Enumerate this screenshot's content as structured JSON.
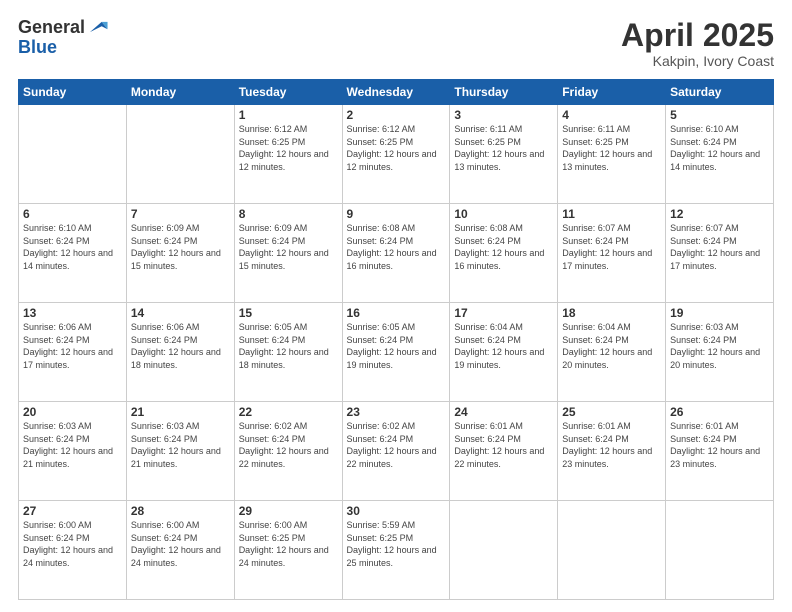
{
  "logo": {
    "general": "General",
    "blue": "Blue"
  },
  "header": {
    "month": "April 2025",
    "location": "Kakpin, Ivory Coast"
  },
  "weekdays": [
    "Sunday",
    "Monday",
    "Tuesday",
    "Wednesday",
    "Thursday",
    "Friday",
    "Saturday"
  ],
  "weeks": [
    [
      {
        "day": "",
        "sunrise": "",
        "sunset": "",
        "daylight": ""
      },
      {
        "day": "",
        "sunrise": "",
        "sunset": "",
        "daylight": ""
      },
      {
        "day": "1",
        "sunrise": "Sunrise: 6:12 AM",
        "sunset": "Sunset: 6:25 PM",
        "daylight": "Daylight: 12 hours and 12 minutes."
      },
      {
        "day": "2",
        "sunrise": "Sunrise: 6:12 AM",
        "sunset": "Sunset: 6:25 PM",
        "daylight": "Daylight: 12 hours and 12 minutes."
      },
      {
        "day": "3",
        "sunrise": "Sunrise: 6:11 AM",
        "sunset": "Sunset: 6:25 PM",
        "daylight": "Daylight: 12 hours and 13 minutes."
      },
      {
        "day": "4",
        "sunrise": "Sunrise: 6:11 AM",
        "sunset": "Sunset: 6:25 PM",
        "daylight": "Daylight: 12 hours and 13 minutes."
      },
      {
        "day": "5",
        "sunrise": "Sunrise: 6:10 AM",
        "sunset": "Sunset: 6:24 PM",
        "daylight": "Daylight: 12 hours and 14 minutes."
      }
    ],
    [
      {
        "day": "6",
        "sunrise": "Sunrise: 6:10 AM",
        "sunset": "Sunset: 6:24 PM",
        "daylight": "Daylight: 12 hours and 14 minutes."
      },
      {
        "day": "7",
        "sunrise": "Sunrise: 6:09 AM",
        "sunset": "Sunset: 6:24 PM",
        "daylight": "Daylight: 12 hours and 15 minutes."
      },
      {
        "day": "8",
        "sunrise": "Sunrise: 6:09 AM",
        "sunset": "Sunset: 6:24 PM",
        "daylight": "Daylight: 12 hours and 15 minutes."
      },
      {
        "day": "9",
        "sunrise": "Sunrise: 6:08 AM",
        "sunset": "Sunset: 6:24 PM",
        "daylight": "Daylight: 12 hours and 16 minutes."
      },
      {
        "day": "10",
        "sunrise": "Sunrise: 6:08 AM",
        "sunset": "Sunset: 6:24 PM",
        "daylight": "Daylight: 12 hours and 16 minutes."
      },
      {
        "day": "11",
        "sunrise": "Sunrise: 6:07 AM",
        "sunset": "Sunset: 6:24 PM",
        "daylight": "Daylight: 12 hours and 17 minutes."
      },
      {
        "day": "12",
        "sunrise": "Sunrise: 6:07 AM",
        "sunset": "Sunset: 6:24 PM",
        "daylight": "Daylight: 12 hours and 17 minutes."
      }
    ],
    [
      {
        "day": "13",
        "sunrise": "Sunrise: 6:06 AM",
        "sunset": "Sunset: 6:24 PM",
        "daylight": "Daylight: 12 hours and 17 minutes."
      },
      {
        "day": "14",
        "sunrise": "Sunrise: 6:06 AM",
        "sunset": "Sunset: 6:24 PM",
        "daylight": "Daylight: 12 hours and 18 minutes."
      },
      {
        "day": "15",
        "sunrise": "Sunrise: 6:05 AM",
        "sunset": "Sunset: 6:24 PM",
        "daylight": "Daylight: 12 hours and 18 minutes."
      },
      {
        "day": "16",
        "sunrise": "Sunrise: 6:05 AM",
        "sunset": "Sunset: 6:24 PM",
        "daylight": "Daylight: 12 hours and 19 minutes."
      },
      {
        "day": "17",
        "sunrise": "Sunrise: 6:04 AM",
        "sunset": "Sunset: 6:24 PM",
        "daylight": "Daylight: 12 hours and 19 minutes."
      },
      {
        "day": "18",
        "sunrise": "Sunrise: 6:04 AM",
        "sunset": "Sunset: 6:24 PM",
        "daylight": "Daylight: 12 hours and 20 minutes."
      },
      {
        "day": "19",
        "sunrise": "Sunrise: 6:03 AM",
        "sunset": "Sunset: 6:24 PM",
        "daylight": "Daylight: 12 hours and 20 minutes."
      }
    ],
    [
      {
        "day": "20",
        "sunrise": "Sunrise: 6:03 AM",
        "sunset": "Sunset: 6:24 PM",
        "daylight": "Daylight: 12 hours and 21 minutes."
      },
      {
        "day": "21",
        "sunrise": "Sunrise: 6:03 AM",
        "sunset": "Sunset: 6:24 PM",
        "daylight": "Daylight: 12 hours and 21 minutes."
      },
      {
        "day": "22",
        "sunrise": "Sunrise: 6:02 AM",
        "sunset": "Sunset: 6:24 PM",
        "daylight": "Daylight: 12 hours and 22 minutes."
      },
      {
        "day": "23",
        "sunrise": "Sunrise: 6:02 AM",
        "sunset": "Sunset: 6:24 PM",
        "daylight": "Daylight: 12 hours and 22 minutes."
      },
      {
        "day": "24",
        "sunrise": "Sunrise: 6:01 AM",
        "sunset": "Sunset: 6:24 PM",
        "daylight": "Daylight: 12 hours and 22 minutes."
      },
      {
        "day": "25",
        "sunrise": "Sunrise: 6:01 AM",
        "sunset": "Sunset: 6:24 PM",
        "daylight": "Daylight: 12 hours and 23 minutes."
      },
      {
        "day": "26",
        "sunrise": "Sunrise: 6:01 AM",
        "sunset": "Sunset: 6:24 PM",
        "daylight": "Daylight: 12 hours and 23 minutes."
      }
    ],
    [
      {
        "day": "27",
        "sunrise": "Sunrise: 6:00 AM",
        "sunset": "Sunset: 6:24 PM",
        "daylight": "Daylight: 12 hours and 24 minutes."
      },
      {
        "day": "28",
        "sunrise": "Sunrise: 6:00 AM",
        "sunset": "Sunset: 6:24 PM",
        "daylight": "Daylight: 12 hours and 24 minutes."
      },
      {
        "day": "29",
        "sunrise": "Sunrise: 6:00 AM",
        "sunset": "Sunset: 6:25 PM",
        "daylight": "Daylight: 12 hours and 24 minutes."
      },
      {
        "day": "30",
        "sunrise": "Sunrise: 5:59 AM",
        "sunset": "Sunset: 6:25 PM",
        "daylight": "Daylight: 12 hours and 25 minutes."
      },
      {
        "day": "",
        "sunrise": "",
        "sunset": "",
        "daylight": ""
      },
      {
        "day": "",
        "sunrise": "",
        "sunset": "",
        "daylight": ""
      },
      {
        "day": "",
        "sunrise": "",
        "sunset": "",
        "daylight": ""
      }
    ]
  ]
}
